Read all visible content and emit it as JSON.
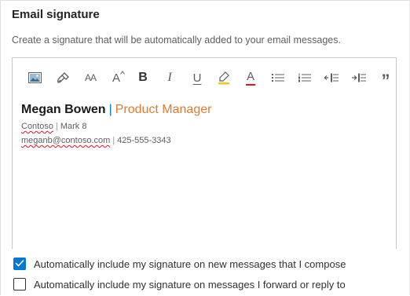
{
  "section": {
    "title": "Email signature",
    "description": "Create a signature that will be automatically added to your email messages."
  },
  "toolbar": {
    "items": [
      {
        "name": "insert-image",
        "icon": "image-icon"
      },
      {
        "name": "format-painter",
        "icon": "paintbrush-icon"
      },
      {
        "name": "font-size",
        "icon": "font-size-icon",
        "glyph": "AA"
      },
      {
        "name": "grow-font",
        "icon": "grow-font-icon",
        "glyph": "A"
      },
      {
        "name": "bold",
        "icon": "bold-icon",
        "glyph": "B"
      },
      {
        "name": "italic",
        "icon": "italic-icon",
        "glyph": "I"
      },
      {
        "name": "underline",
        "icon": "underline-icon",
        "glyph": "U"
      },
      {
        "name": "highlight",
        "icon": "highlighter-icon"
      },
      {
        "name": "font-color",
        "icon": "font-color-icon",
        "glyph": "A"
      },
      {
        "name": "bullets",
        "icon": "bulleted-list-icon"
      },
      {
        "name": "numbering",
        "icon": "numbered-list-icon"
      },
      {
        "name": "decrease-indent",
        "icon": "decrease-indent-icon"
      },
      {
        "name": "increase-indent",
        "icon": "increase-indent-icon"
      },
      {
        "name": "quote",
        "icon": "quote-icon",
        "glyph": "”"
      }
    ]
  },
  "signature": {
    "name": "Megan Bowen",
    "separator": "|",
    "role": "Product Manager",
    "company": "Contoso",
    "company_separator": "|",
    "location": "Mark 8",
    "email": "meganb@contoso.com",
    "phone_separator": "|",
    "phone": "425-555-3343"
  },
  "options": {
    "new_messages": {
      "label": "Automatically include my signature on new messages that I compose",
      "checked": true
    },
    "forward_reply": {
      "label": "Automatically include my signature on messages I forward or reply to",
      "checked": false
    }
  },
  "colors": {
    "accent": "#0078d4",
    "role_text": "#e07b2c",
    "highlight": "#f2c811",
    "font_color_bar": "#e81123"
  }
}
